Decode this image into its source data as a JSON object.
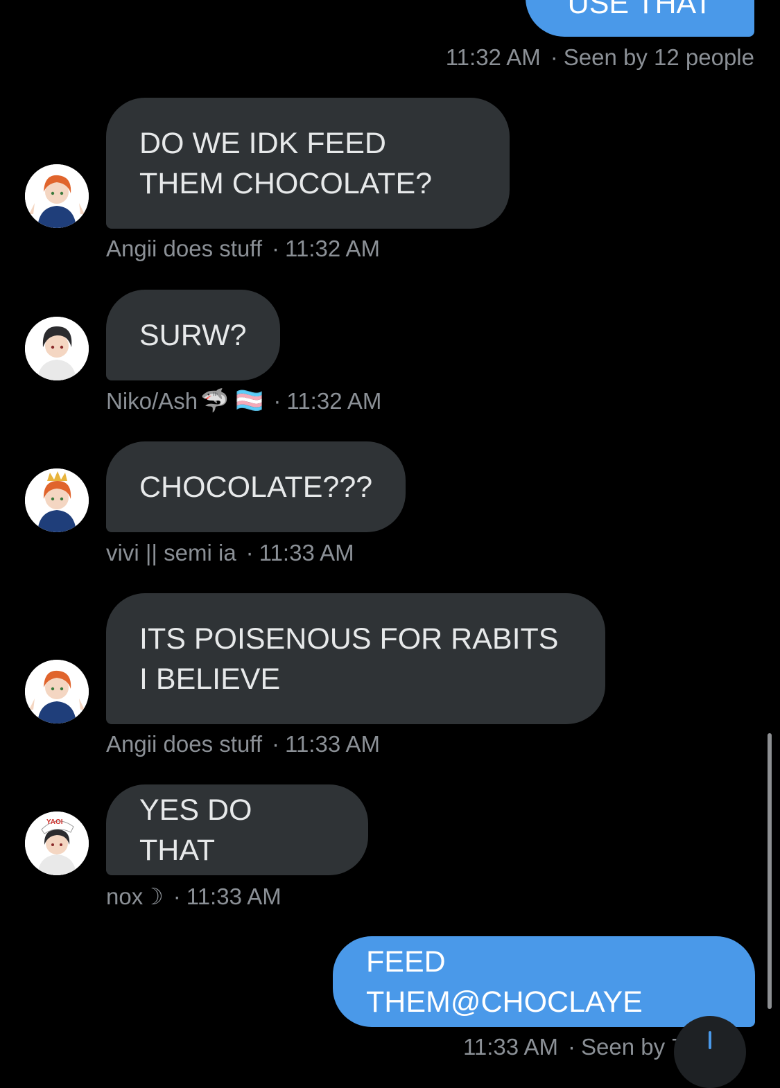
{
  "top_message": {
    "text": "USE THAT",
    "time": "11:32 AM",
    "seen": "Seen by 12 people"
  },
  "messages": [
    {
      "text": "DO WE IDK FEED THEM CHOCOLATE?",
      "sender": "Angii does stuff",
      "time": "11:32 AM"
    },
    {
      "text": "SURW?",
      "sender": "Niko/Ash",
      "sender_emoji": "🦈 🏳️‍⚧️",
      "time": "11:32 AM"
    },
    {
      "text": "CHOCOLATE???",
      "sender": "vivi || semi ia",
      "time": "11:33 AM"
    },
    {
      "text": "ITS POISENOUS FOR RABITS I BELIEVE",
      "sender": "Angii does stuff",
      "time": "11:33 AM"
    },
    {
      "text": "YES DO THAT",
      "sender": "nox☽",
      "time": "11:33 AM",
      "avatar_hat_text": "YAOI"
    }
  ],
  "outgoing": {
    "text": "FEED THEM@CHOCLAYE",
    "time": "11:33 AM",
    "seen": "Seen by 7"
  },
  "meta_separator": "·",
  "icons": {
    "scroll_down": "arrow-down-icon"
  },
  "colors": {
    "background": "#000000",
    "incoming_bubble": "#2f3336",
    "outgoing_bubble": "#4a99e9",
    "meta_text": "#8b9096"
  }
}
